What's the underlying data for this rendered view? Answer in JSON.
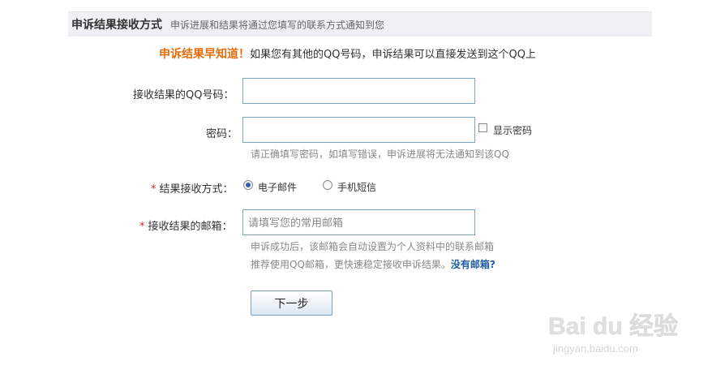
{
  "header": {
    "title": "申诉结果接收方式",
    "subtitle": "申诉进展和结果将通过您填写的联系方式通知到您"
  },
  "notice": {
    "highlight": "申诉结果早知道！",
    "text": "如果您有其他的QQ号码，申诉结果可以直接发送到这个QQ上"
  },
  "form": {
    "qq_label": "接收结果的QQ号码：",
    "qq_value": "",
    "password_label": "密码：",
    "password_value": "",
    "show_password_label": "显示密码",
    "show_password_checked": false,
    "password_hint": "请正确填写密码，如填写错误，申诉进展将无法通知到该QQ",
    "method_required_mark": "*",
    "method_label": "结果接收方式：",
    "method_options": [
      {
        "label": "电子邮件",
        "checked": true
      },
      {
        "label": "手机短信",
        "checked": false
      }
    ],
    "email_required_mark": "*",
    "email_label": "接收结果的邮箱：",
    "email_placeholder": "请填写您的常用邮箱",
    "email_hint_line1": "申诉成功后，该邮箱会自动设置为个人资料中的联系邮箱",
    "email_hint_line2": "推荐使用QQ邮箱，更快速稳定接收申诉结果。",
    "no_mailbox_link": "没有邮箱?",
    "next_button": "下一步"
  },
  "watermark": {
    "brand": "Bai du 经验",
    "url": "jingyan.baidu.com"
  },
  "colors": {
    "accent_orange": "#e46d0b",
    "required_red": "#d9252a",
    "link_blue": "#1f5fa5",
    "input_border": "#7aa7c6"
  }
}
